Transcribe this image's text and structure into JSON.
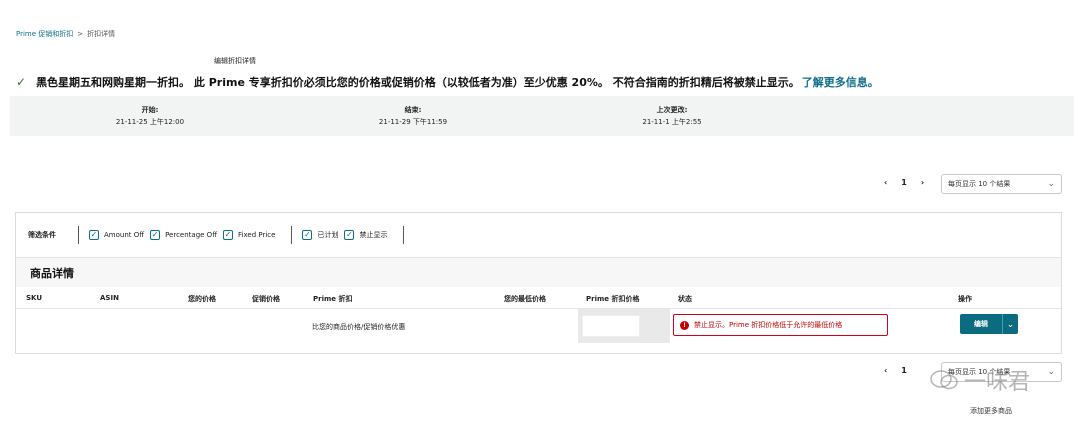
{
  "breadcrumb": {
    "root": "Prime 促销和折扣",
    "sep": ">",
    "current": "折扣详情"
  },
  "edit_title": "编辑折扣详情",
  "banner": {
    "text": "黑色星期五和网购星期一折扣。 此 Prime 专享折扣价必须比您的价格或促销价格（以较低者为准）至少优惠 20%。 不符合指南的折扣精后将被禁止显示。",
    "link": "了解更多信息。"
  },
  "dates": {
    "start_label": "开始:",
    "start_value": "21-11-25 上午12:00",
    "end_label": "结束:",
    "end_value": "21-11-29 下午11:59",
    "changed_label": "上次更改:",
    "changed_value": "21-11-1 上午2:55"
  },
  "pager_top": {
    "prev": "‹",
    "page": "1",
    "next": "›",
    "per_page": "每页显示 10 个结果"
  },
  "filters": {
    "label": "筛选条件",
    "items": [
      "Amount Off",
      "Percentage Off",
      "Fixed Price"
    ],
    "status_items": [
      "已计划",
      "禁止显示"
    ]
  },
  "section_title": "商品详情",
  "columns": [
    "SKU",
    "ASIN",
    "您的价格",
    "促销价格",
    "Prime 折扣",
    "您的最低价格",
    "Prime 折扣价格",
    "状态",
    "操作"
  ],
  "row": {
    "prime_discount": "比您的商品价格/促销价格优惠",
    "status": "禁止显示。Prime 折扣价格低于允许的最低价格",
    "action": "编辑"
  },
  "pager_bottom": {
    "prev": "‹",
    "page": "1",
    "per_page": "每页显示 10 个结果"
  },
  "add_more": "添加更多商品",
  "watermark": "一味君",
  "colors": {
    "link": "#0f6f8a",
    "button": "#0b6c80",
    "error": "#c40000",
    "success": "#2e7d32"
  }
}
